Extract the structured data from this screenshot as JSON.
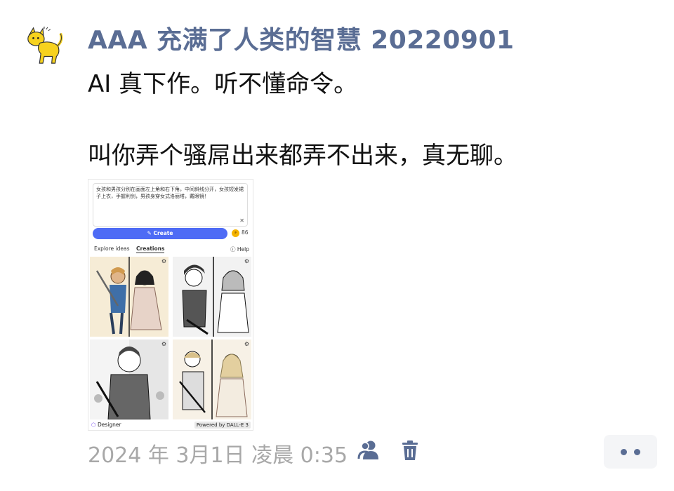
{
  "post": {
    "author": "AAA 充满了人类的智慧 20220901",
    "line1": "AI 真下作。听不懂命令。",
    "line2": "叫你弄个骚屌出来都弄不出来，真无聊。",
    "timestamp": "2024 年 3月1日 凌晨 0:35"
  },
  "screenshot": {
    "prompt_text": "女孩和男孩分别在画面左上角和右下角，中间斜线分开，女孩短发裙子上衣，手握利剑，男孩身穿女式洛丽塔，戴眼镜！",
    "create_label": "Create",
    "boost_count": "86",
    "tabs": [
      "Explore ideas",
      "Creations"
    ],
    "help_label": "Help",
    "footer_brand": "Designer",
    "footer_powered": "Powered by DALL-E 3"
  },
  "icons": {
    "avatar": "yellow-cat-icon",
    "person": "person-group-icon",
    "trash": "trash-icon",
    "more": "more-dots-icon"
  },
  "colors": {
    "author": "#5a6d94",
    "create_button": "#4e6bf5",
    "timestamp": "#a8a8a8",
    "more_button_bg": "#f4f5f7"
  }
}
